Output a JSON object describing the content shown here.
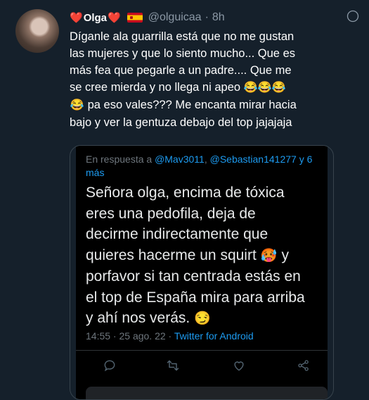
{
  "author": {
    "display_name": "Olga",
    "heart_left": "❤️",
    "heart_right": "❤️",
    "flag": "spain-flag",
    "handle": "@olguicaa",
    "separator": "·",
    "time": "8h"
  },
  "tweet": {
    "lines": [
      "Díganle ala guarrilla está que no me gustan",
      "las mujeres y que lo siento mucho...  Que es",
      "más fea que pegarle a un padre....  Que me",
      "se cree mierda y no llega ni apeo",
      "pa eso vales??? Me encanta mirar hacia",
      "bajo y ver la gentuza debajo del top jajajaja"
    ],
    "emoji_line4": "😂😂😂",
    "emoji_line5": "😂"
  },
  "embedded": {
    "reply_prefix": "En respuesta a",
    "mention1": "@Mav3011",
    "comma": ",",
    "mention2": "@Sebastian141277",
    "mention3": "y 6",
    "mention4": "más",
    "text_lines": [
      "Señora olga, encima de tóxica",
      "eres una pedofila, deja de",
      "decirme indirectamente que",
      "quieres hacerme un squirt",
      "porfavor si tan centrada estás en",
      "el top de España mira para arriba",
      "y ahí nos verás."
    ],
    "emoji_squirt": "🥵",
    "emoji_line4_tail": "y",
    "emoji_end": "😏",
    "timestamp": "14:55 · 25 ago. 22 ·",
    "app": "Twitter for Android"
  },
  "icons": {
    "more": "more-options-icon",
    "reply": "reply-icon",
    "retweet": "retweet-icon",
    "like": "like-icon",
    "share": "share-icon"
  }
}
